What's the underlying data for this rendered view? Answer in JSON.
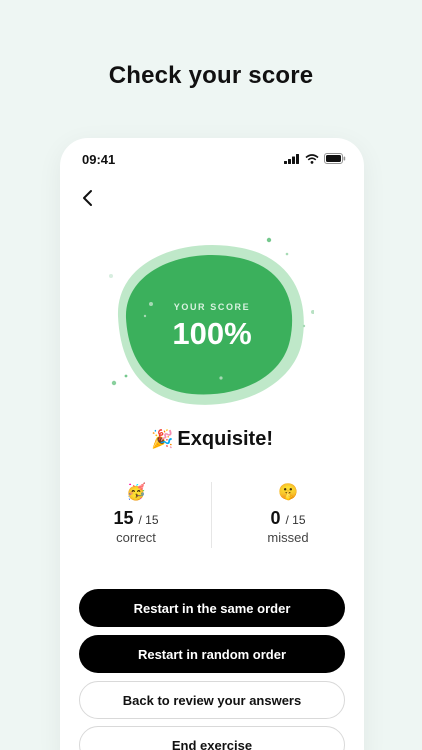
{
  "headline": "Check your score",
  "status_bar": {
    "time": "09:41"
  },
  "score": {
    "label": "YOUR SCORE",
    "value": "100%"
  },
  "result": {
    "emoji": "🎉",
    "title": "Exquisite!"
  },
  "stats": {
    "correct": {
      "emoji": "🥳",
      "count": "15",
      "total": "/ 15",
      "label": "correct"
    },
    "missed": {
      "emoji": "🤫",
      "count": "0",
      "total": "/ 15",
      "label": "missed"
    }
  },
  "buttons": {
    "restart_same": "Restart in the same order",
    "restart_random": "Restart in random order",
    "review": "Back to review your answers",
    "end": "End exercise"
  },
  "colors": {
    "accent": "#3bb05c",
    "accent_light": "#bfe8c9",
    "background": "#eef6f3"
  },
  "icons": [
    "back-chevron-icon",
    "signal-icon",
    "wifi-icon",
    "battery-icon"
  ]
}
